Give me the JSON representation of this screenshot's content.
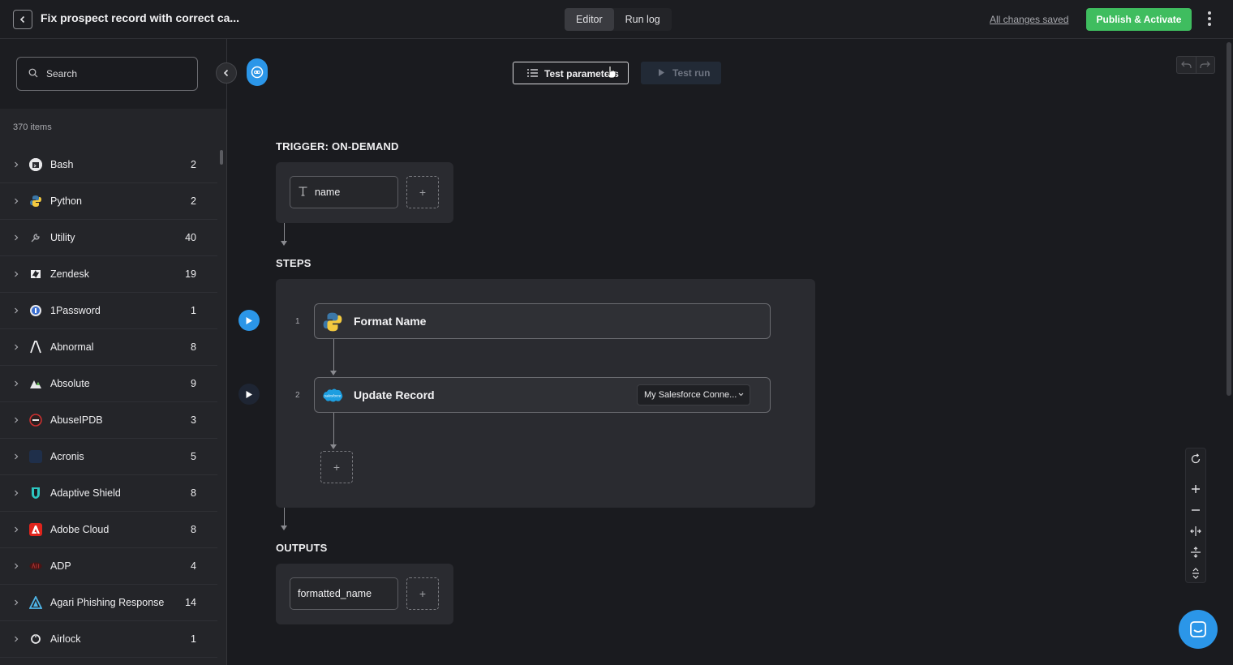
{
  "topbar": {
    "title": "Fix prospect record with correct ca...",
    "tabs": [
      "Editor",
      "Run log"
    ],
    "active_tab": "Editor",
    "saved_status": "All changes saved",
    "publish_label": "Publish & Activate",
    "publish_color": "#3fbd5f"
  },
  "sidebar": {
    "search_placeholder": "Search",
    "items_count": "370 items",
    "items": [
      {
        "name": "Bash",
        "count": "2",
        "icon": "bash-logo"
      },
      {
        "name": "Python",
        "count": "2",
        "icon": "python-logo"
      },
      {
        "name": "Utility",
        "count": "40",
        "icon": "wrench-icon"
      },
      {
        "name": "Zendesk",
        "count": "19",
        "icon": "zendesk-logo"
      },
      {
        "name": "1Password",
        "count": "1",
        "icon": "1password-logo"
      },
      {
        "name": "Abnormal",
        "count": "8",
        "icon": "abnormal-logo"
      },
      {
        "name": "Absolute",
        "count": "9",
        "icon": "absolute-logo"
      },
      {
        "name": "AbuseIPDB",
        "count": "3",
        "icon": "abuseipdb-logo"
      },
      {
        "name": "Acronis",
        "count": "5",
        "icon": "acronis-logo"
      },
      {
        "name": "Adaptive Shield",
        "count": "8",
        "icon": "adaptive-shield-logo"
      },
      {
        "name": "Adobe Cloud",
        "count": "8",
        "icon": "adobe-logo"
      },
      {
        "name": "ADP",
        "count": "4",
        "icon": "adp-logo"
      },
      {
        "name": "Agari Phishing Response",
        "count": "14",
        "icon": "agari-logo"
      },
      {
        "name": "Airlock",
        "count": "1",
        "icon": "airlock-logo"
      }
    ]
  },
  "toolbar": {
    "test_params_label": "Test parameters",
    "test_run_label": "Test run"
  },
  "trigger": {
    "heading": "TRIGGER: ON-DEMAND",
    "param_name": "name"
  },
  "steps": {
    "heading": "STEPS",
    "list": [
      {
        "number": "1",
        "title": "Format Name",
        "icon": "python-logo"
      },
      {
        "number": "2",
        "title": "Update Record",
        "icon": "salesforce-logo",
        "connection": "My Salesforce Conne..."
      }
    ]
  },
  "outputs": {
    "heading": "OUTPUTS",
    "field": "formatted_name"
  },
  "colors": {
    "accent_blue": "#2b96e8",
    "background": "#1a1b1f"
  }
}
